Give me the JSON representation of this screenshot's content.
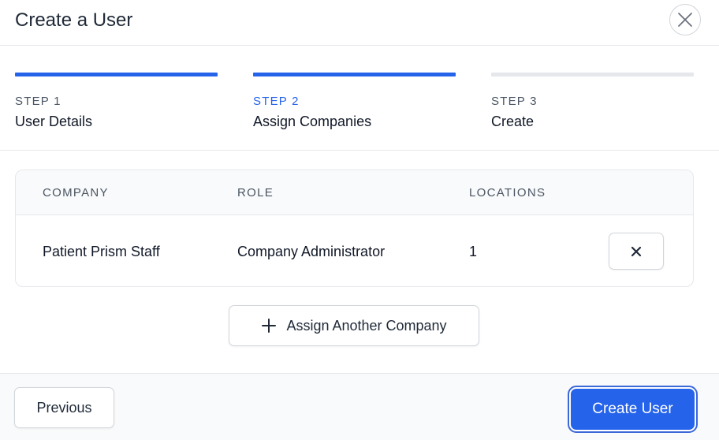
{
  "modal": {
    "title": "Create a User"
  },
  "colors": {
    "accent": "#2563eb",
    "inactive_step": "#e5e7eb"
  },
  "steps": [
    {
      "number": "STEP 1",
      "name": "User Details",
      "state": "complete"
    },
    {
      "number": "STEP 2",
      "name": "Assign Companies",
      "state": "current"
    },
    {
      "number": "STEP 3",
      "name": "Create",
      "state": "upcoming"
    }
  ],
  "table": {
    "columns": [
      "COMPANY",
      "ROLE",
      "LOCATIONS"
    ],
    "rows": [
      {
        "company": "Patient Prism Staff",
        "role": "Company Administrator",
        "locations": "1"
      }
    ]
  },
  "actions": {
    "assign_another": "Assign Another Company",
    "previous": "Previous",
    "create_user": "Create User"
  },
  "icons": {
    "close": "close-icon",
    "remove": "remove-icon",
    "plus": "plus-icon"
  }
}
